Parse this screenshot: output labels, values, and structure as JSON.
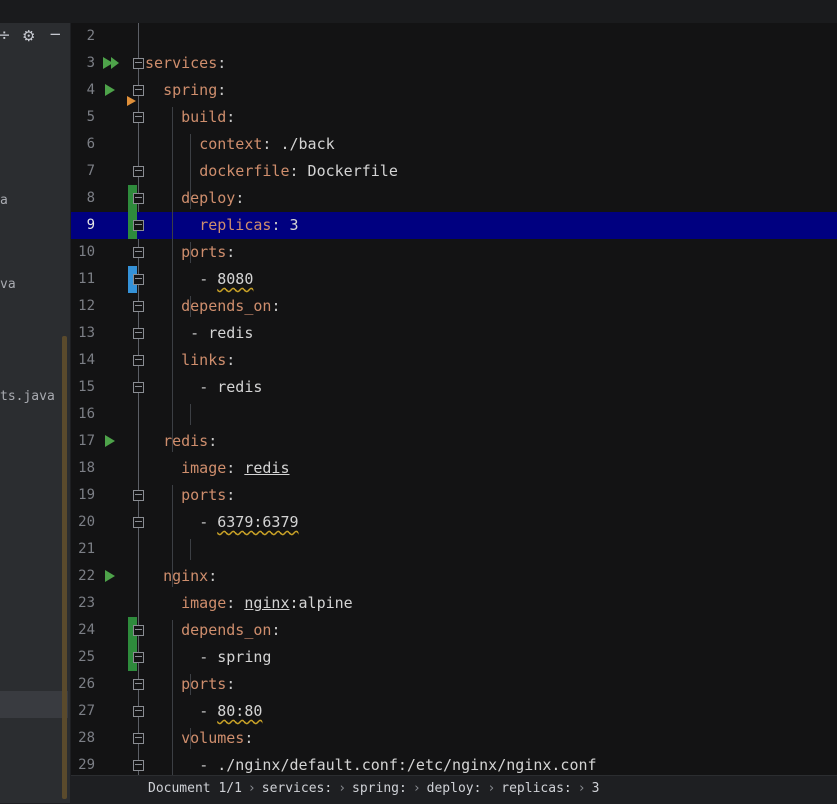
{
  "toolbar": {
    "collapse_icon": "minus-plus",
    "settings_icon": "gear",
    "hide_icon": "minus"
  },
  "sidebar": {
    "items": [
      {
        "label": "a"
      },
      {
        "label": "va"
      },
      {
        "label": "ts.java"
      }
    ]
  },
  "editor": {
    "lines": [
      {
        "num": "2",
        "indent": "",
        "key": "",
        "punc": "",
        "val": ""
      },
      {
        "num": "3",
        "indent": "",
        "key": "services",
        "punc": ":",
        "val": ""
      },
      {
        "num": "4",
        "indent": "  ",
        "key": "spring",
        "punc": ":",
        "val": ""
      },
      {
        "num": "5",
        "indent": "    ",
        "key": "build",
        "punc": ":",
        "val": ""
      },
      {
        "num": "6",
        "indent": "      ",
        "key": "context",
        "punc": ":",
        "val": " ./back"
      },
      {
        "num": "7",
        "indent": "      ",
        "key": "dockerfile",
        "punc": ":",
        "val": " Dockerfile"
      },
      {
        "num": "8",
        "indent": "    ",
        "key": "deploy",
        "punc": ":",
        "val": ""
      },
      {
        "num": "9",
        "indent": "      ",
        "key": "replicas",
        "punc": ":",
        "val": " 3"
      },
      {
        "num": "10",
        "indent": "    ",
        "key": "ports",
        "punc": ":",
        "val": ""
      },
      {
        "num": "11",
        "indent": "      ",
        "key": "",
        "punc": "- ",
        "val": "8080"
      },
      {
        "num": "12",
        "indent": "    ",
        "key": "depends_on",
        "punc": ":",
        "val": ""
      },
      {
        "num": "13",
        "indent": "     ",
        "key": "",
        "punc": "- ",
        "val": "redis"
      },
      {
        "num": "14",
        "indent": "    ",
        "key": "links",
        "punc": ":",
        "val": ""
      },
      {
        "num": "15",
        "indent": "      ",
        "key": "",
        "punc": "- ",
        "val": "redis"
      },
      {
        "num": "16",
        "indent": "",
        "key": "",
        "punc": "",
        "val": ""
      },
      {
        "num": "17",
        "indent": "  ",
        "key": "redis",
        "punc": ":",
        "val": ""
      },
      {
        "num": "18",
        "indent": "    ",
        "key": "image",
        "punc": ": ",
        "val": "redis"
      },
      {
        "num": "19",
        "indent": "    ",
        "key": "ports",
        "punc": ":",
        "val": ""
      },
      {
        "num": "20",
        "indent": "      ",
        "key": "",
        "punc": "- ",
        "val": "6379:6379"
      },
      {
        "num": "21",
        "indent": "",
        "key": "",
        "punc": "",
        "val": ""
      },
      {
        "num": "22",
        "indent": "  ",
        "key": "nginx",
        "punc": ":",
        "val": ""
      },
      {
        "num": "23",
        "indent": "    ",
        "key": "image",
        "punc": ": ",
        "val": "nginx:alpine"
      },
      {
        "num": "24",
        "indent": "    ",
        "key": "depends_on",
        "punc": ":",
        "val": ""
      },
      {
        "num": "25",
        "indent": "      ",
        "key": "",
        "punc": "- ",
        "val": "spring"
      },
      {
        "num": "26",
        "indent": "    ",
        "key": "ports",
        "punc": ":",
        "val": ""
      },
      {
        "num": "27",
        "indent": "      ",
        "key": "",
        "punc": "- ",
        "val": "80:80"
      },
      {
        "num": "28",
        "indent": "    ",
        "key": "volumes",
        "punc": ":",
        "val": ""
      },
      {
        "num": "29",
        "indent": "      ",
        "key": "",
        "punc": "- ",
        "val": "./nginx/default.conf:/etc/nginx/nginx.conf"
      }
    ],
    "current_line": "9"
  },
  "status": {
    "breadcrumbs": [
      "Document 1/1",
      "services:",
      "spring:",
      "deploy:",
      "replicas:",
      "3"
    ]
  },
  "colors": {
    "key": "#cf8e6d",
    "current_line_bg": "#000080",
    "run_icon": "#4ea34a",
    "vcs_added": "#2e8b3c",
    "vcs_modified": "#3592d8",
    "bookmark": "#e0903a"
  }
}
